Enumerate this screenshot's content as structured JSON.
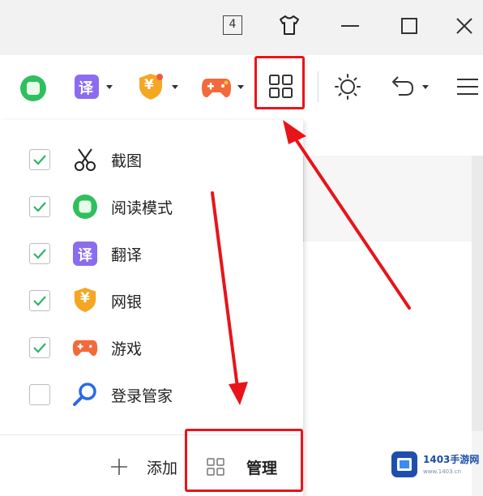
{
  "titlebar": {
    "tab_count": "4"
  },
  "toolbar": {
    "tools": [
      {
        "name": "reading-mode",
        "color": "#2fbf5f"
      },
      {
        "name": "translate",
        "glyph": "译",
        "color": "#8b6cf0"
      },
      {
        "name": "online-bank",
        "glyph": "¥",
        "color": "#f5a623"
      },
      {
        "name": "game",
        "color": "#f26a3b"
      },
      {
        "name": "manage-grid"
      },
      {
        "name": "brightness"
      },
      {
        "name": "undo"
      },
      {
        "name": "menu"
      }
    ]
  },
  "panel": {
    "items": [
      {
        "label": "截图",
        "checked": true,
        "icon": "scissors-icon"
      },
      {
        "label": "阅读模式",
        "checked": true,
        "icon": "reading-mode-icon"
      },
      {
        "label": "翻译",
        "checked": true,
        "icon": "translate-icon",
        "icon_glyph": "译"
      },
      {
        "label": "网银",
        "checked": true,
        "icon": "bank-shield-icon",
        "icon_glyph": "¥"
      },
      {
        "label": "游戏",
        "checked": true,
        "icon": "gamepad-icon"
      },
      {
        "label": "登录管家",
        "checked": false,
        "icon": "magnifier-key-icon"
      }
    ],
    "add_label": "添加",
    "manage_label": "管理"
  },
  "colors": {
    "accent_check": "#2db36b",
    "highlight": "#e8141a"
  },
  "watermark": {
    "text": "1403手游网",
    "sub": "www.1403.cn"
  }
}
